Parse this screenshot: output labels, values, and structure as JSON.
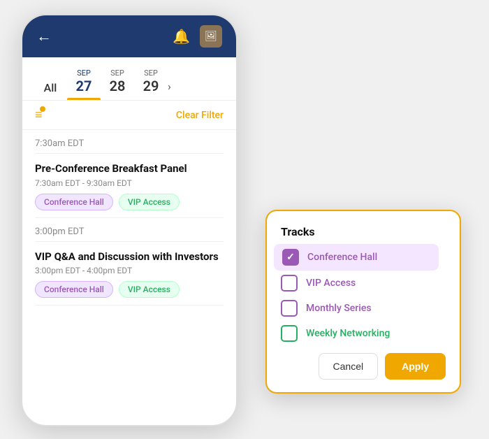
{
  "header": {
    "back_label": "←",
    "bell_icon": "🔔",
    "avatar_label": "👤"
  },
  "date_tabs": {
    "all_label": "All",
    "tabs": [
      {
        "month": "SEP",
        "day": "27",
        "active": true
      },
      {
        "month": "SEP",
        "day": "28",
        "active": false
      },
      {
        "month": "SEP",
        "day": "29",
        "active": false
      }
    ],
    "next_arrow": "›"
  },
  "filter_bar": {
    "clear_filter_label": "Clear Filter"
  },
  "sessions": [
    {
      "time": "7:30am EDT",
      "title": "Pre-Conference Breakfast Panel",
      "session_time": "7:30am EDT - 9:30am EDT",
      "tags": [
        {
          "label": "Conference Hall",
          "type": "purple"
        },
        {
          "label": "VIP Access",
          "type": "green"
        }
      ]
    },
    {
      "time": "3:00pm EDT",
      "title": "VIP Q&A and Discussion with Investors",
      "session_time": "3:00pm EDT - 4:00pm EDT",
      "tags": [
        {
          "label": "Conference Hall",
          "type": "purple"
        },
        {
          "label": "VIP Access",
          "type": "green"
        }
      ]
    }
  ],
  "tracks_panel": {
    "title": "Tracks",
    "options": [
      {
        "label": "Conference Hall",
        "checked": true,
        "color": "purple"
      },
      {
        "label": "VIP Access",
        "checked": false,
        "color": "purple"
      },
      {
        "label": "Monthly Series",
        "checked": false,
        "color": "purple"
      },
      {
        "label": "Weekly Networking",
        "checked": false,
        "color": "green"
      }
    ],
    "cancel_label": "Cancel",
    "apply_label": "Apply"
  }
}
